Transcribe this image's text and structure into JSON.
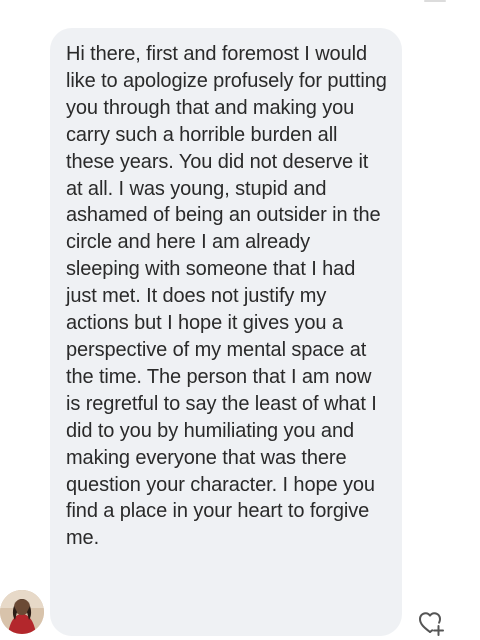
{
  "message": {
    "text": "Hi there, first and foremost I would like to apologize profusely for putting you through that and making you carry such a horrible burden all these years. You did not deserve it at all. I was young, stupid and ashamed of being an outsider in the circle and here I am already sleeping with someone that I had just met. It does not justify my actions but I hope it gives you a perspective of my mental space at the time. The person that I am now is regretful to say the least of what I did to you by humiliating you and making everyone that was there question your character. I hope you find a place in your heart to forgive me."
  },
  "icons": {
    "avatar": "profile-photo",
    "reaction": "heart-add-icon"
  },
  "colors": {
    "bubble": "#eff1f4",
    "text": "#2a2a2a",
    "icon": "#555555"
  }
}
